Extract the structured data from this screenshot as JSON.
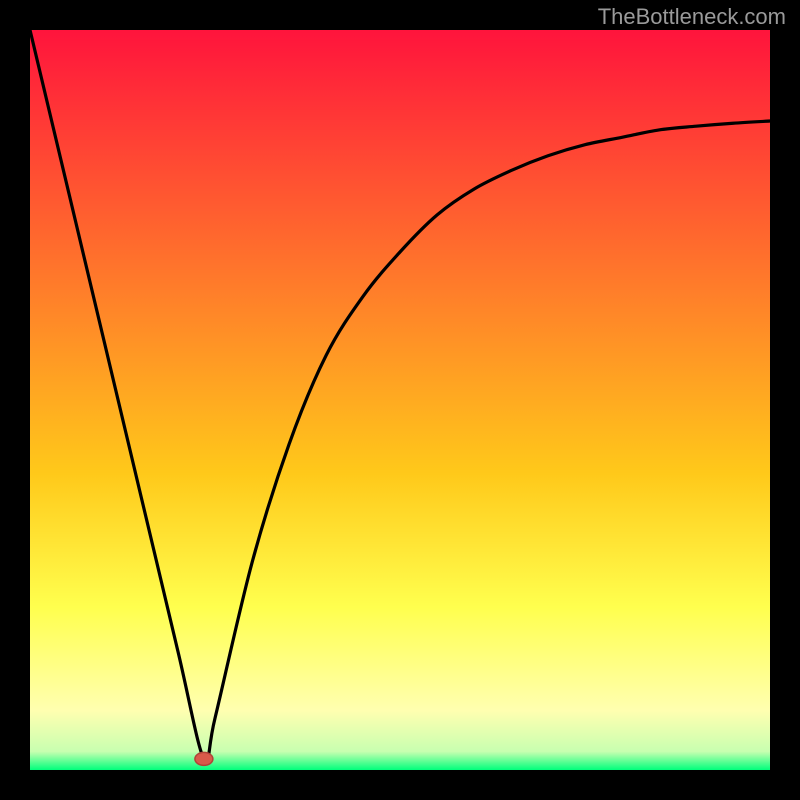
{
  "watermark": "TheBottleneck.com",
  "colors": {
    "top": "#ff143c",
    "mid_upper": "#ff7d2a",
    "mid": "#ffc91a",
    "mid_lower": "#ffff4e",
    "pale_yellow": "#ffffb0",
    "green": "#00ff7c",
    "frame": "#000000",
    "curve": "#000000",
    "marker_fill": "#d85a4a",
    "marker_stroke": "#b04438"
  },
  "chart_data": {
    "type": "line",
    "title": "",
    "xlabel": "",
    "ylabel": "",
    "xlim": [
      0,
      100
    ],
    "ylim": [
      0,
      100
    ],
    "grid": false,
    "legend": false,
    "series": [
      {
        "name": "bottleneck-curve",
        "x": [
          0,
          5,
          10,
          15,
          20,
          23.5,
          25,
          30,
          35,
          40,
          45,
          50,
          55,
          60,
          65,
          70,
          75,
          80,
          85,
          90,
          95,
          100
        ],
        "y": [
          100,
          79,
          58,
          37,
          16,
          1.5,
          7,
          28,
          44,
          56,
          64,
          70,
          75,
          78.5,
          81,
          83,
          84.5,
          85.5,
          86.5,
          87,
          87.4,
          87.7
        ]
      }
    ],
    "marker": {
      "x": 23.5,
      "y": 1.5
    },
    "gradient_stops": [
      {
        "offset": 0.0,
        "color": "#ff143c"
      },
      {
        "offset": 0.35,
        "color": "#ff7d2a"
      },
      {
        "offset": 0.6,
        "color": "#ffc91a"
      },
      {
        "offset": 0.78,
        "color": "#ffff4e"
      },
      {
        "offset": 0.92,
        "color": "#ffffb0"
      },
      {
        "offset": 0.975,
        "color": "#c8ffb0"
      },
      {
        "offset": 1.0,
        "color": "#00ff7c"
      }
    ]
  }
}
